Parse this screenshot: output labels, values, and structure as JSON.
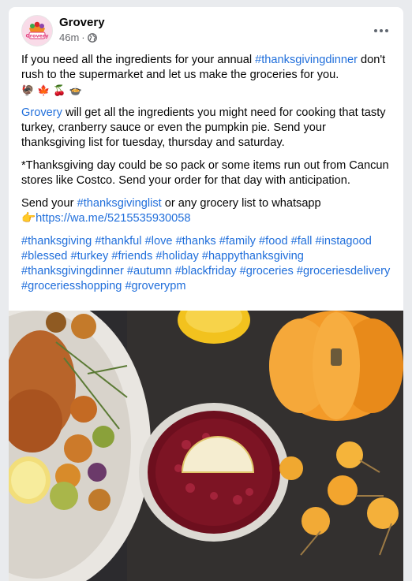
{
  "post": {
    "author": "Grovery",
    "timestamp": "46m",
    "separator": "·",
    "avatar_logo_text": "Grovery",
    "p1": {
      "text_a": "If you need all the ingredients for your annual ",
      "hashtag": "#thanksgivingdinner",
      "text_b": " don't rush to the supermarket and let us make the groceries for you."
    },
    "p1_emojis": [
      "🦃",
      "🍁",
      "🍒",
      "🍲"
    ],
    "p2": {
      "mention": "Grovery",
      "text": " will get all the ingredients you might need for cooking that tasty turkey, cranberry sauce or even the pumpkin pie. Send your thanksgiving list for tuesday, thursday and saturday."
    },
    "p3": "*Thanksgiving day could be so pack or some items run out from Cancun stores like Costco. Send your order for that day with anticipation.",
    "p4": {
      "text_a": "Send your ",
      "hashtag": "#thanksgivinglist",
      "text_b": " or any grocery list to whatsapp",
      "pointer": "👉",
      "link": "https://wa.me/5215535930058"
    },
    "hashtags": [
      "#thanksgiving",
      "#thankful",
      "#love",
      "#thanks",
      "#family",
      "#food",
      "#fall",
      "#instagood",
      "#blessed",
      "#turkey",
      "#friends",
      "#holiday",
      "#happythanksgiving",
      "#thanksgivingdinner",
      "#autumn",
      "#blackfriday",
      "#groceries",
      "#groceriesdelivery",
      "#groceriesshopping",
      "#groverypm"
    ]
  },
  "icons": {
    "more": "more-options-icon",
    "privacy": "globe-icon"
  },
  "colors": {
    "link": "#216fdb",
    "text": "#050505",
    "meta": "#65676b",
    "background": "#e9ebee"
  }
}
